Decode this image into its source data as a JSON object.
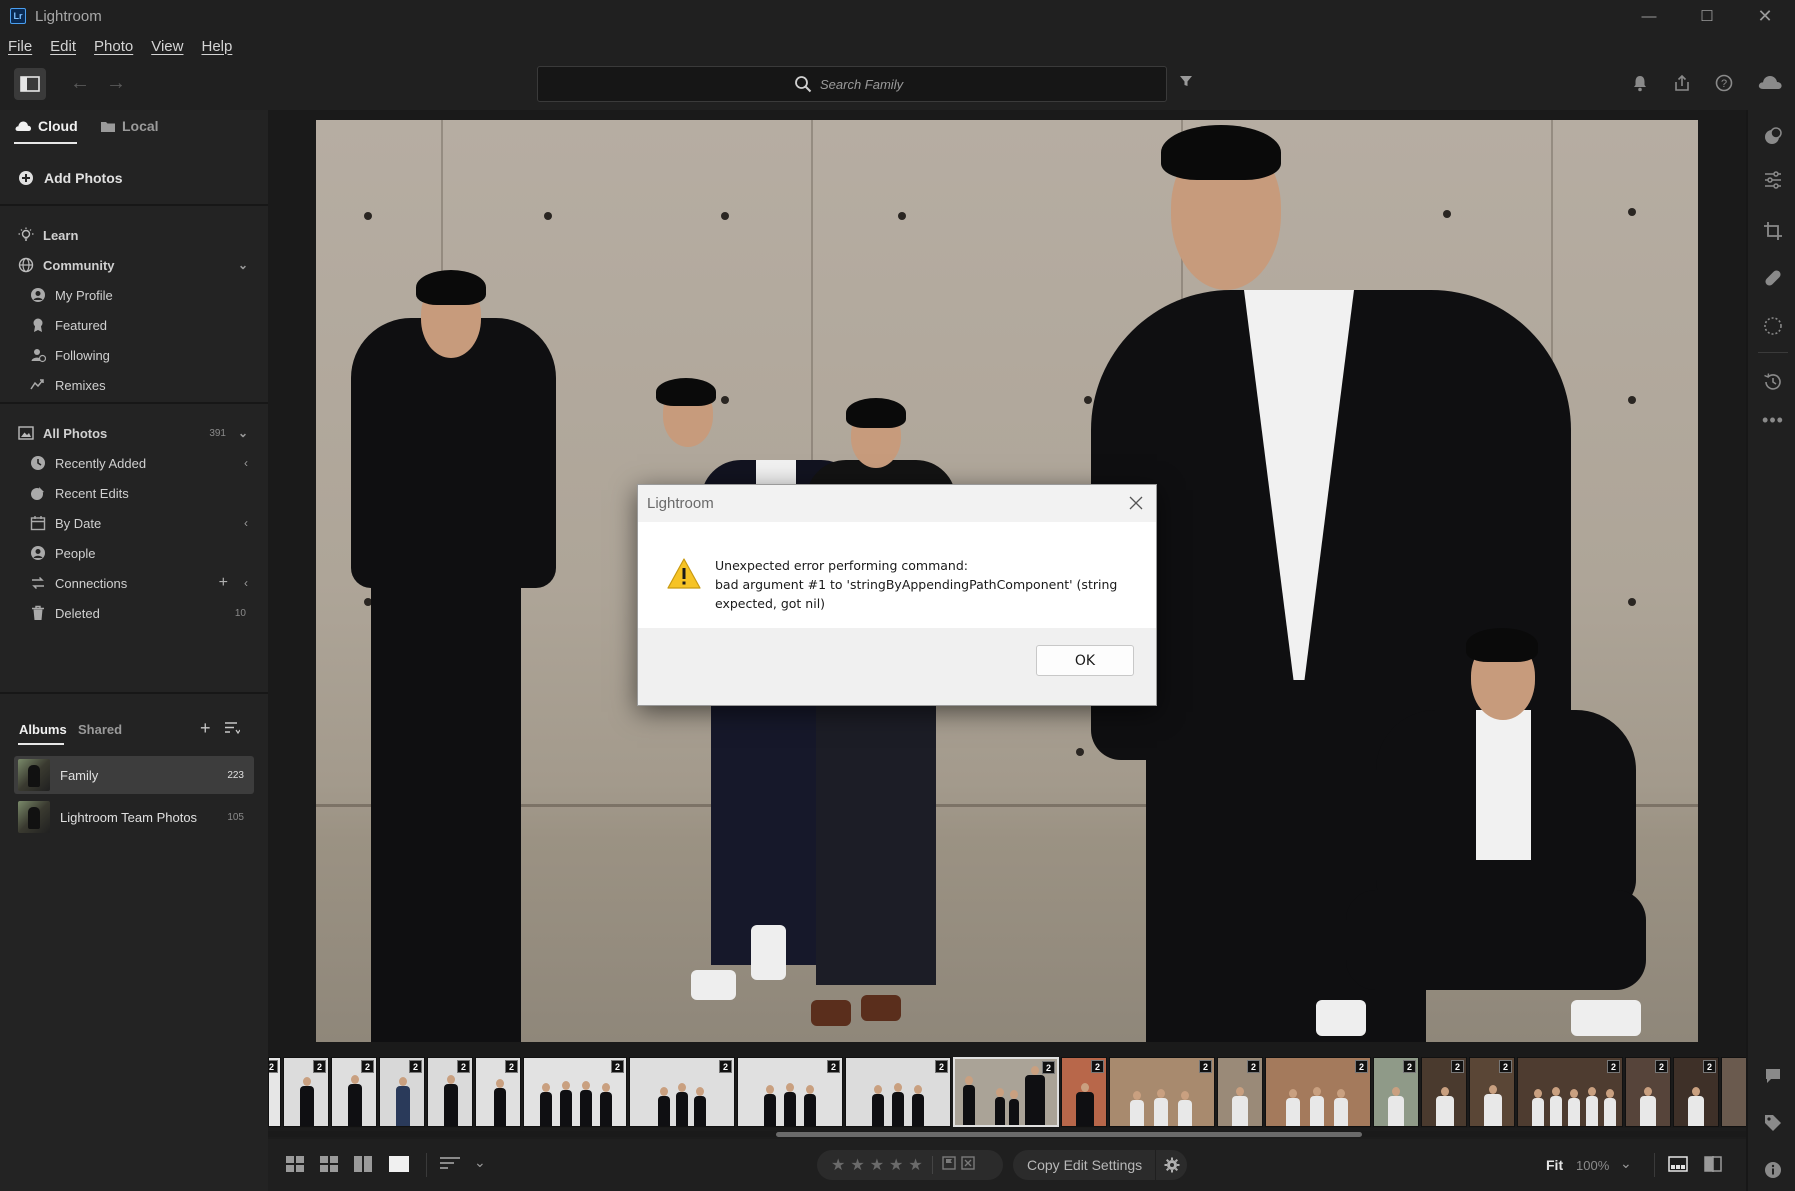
{
  "window": {
    "title": "Lightroom",
    "logo": "Lr",
    "controls": {
      "minimize": "—",
      "maximize": "☐",
      "close": "✕"
    }
  },
  "menu": [
    "File",
    "Edit",
    "Photo",
    "View",
    "Help"
  ],
  "toolbar": {
    "search_placeholder": "Search Family"
  },
  "left_panel": {
    "tabs": [
      {
        "label": "Cloud",
        "active": true
      },
      {
        "label": "Local",
        "active": false
      }
    ],
    "add_photos": "Add Photos",
    "learn": "Learn",
    "community": {
      "label": "Community",
      "items": [
        "My Profile",
        "Featured",
        "Following",
        "Remixes"
      ]
    },
    "all_photos": {
      "label": "All Photos",
      "count": "391"
    },
    "library_items": [
      {
        "label": "Recently Added"
      },
      {
        "label": "Recent Edits"
      },
      {
        "label": "By Date"
      },
      {
        "label": "People"
      },
      {
        "label": "Connections"
      },
      {
        "label": "Deleted",
        "count": "10"
      }
    ],
    "album_tabs": [
      {
        "label": "Albums",
        "active": true
      },
      {
        "label": "Shared",
        "active": false
      }
    ],
    "albums": [
      {
        "label": "Family",
        "count": "223",
        "selected": true
      },
      {
        "label": "Lightroom Team Photos",
        "count": "105",
        "selected": false
      }
    ]
  },
  "dialog": {
    "title": "Lightroom",
    "line1": "Unexpected error performing command:",
    "line2": "bad argument #1 to 'stringByAppendingPathComponent' (string expected, got nil)",
    "ok_label": "OK"
  },
  "filmstrip": {
    "badge": "2"
  },
  "bottom_bar": {
    "copy_edit_settings": "Copy Edit Settings",
    "fit": "Fit",
    "zoom": "100%"
  },
  "colors": {
    "accent": "#e8e8e8",
    "warning": "#f6c325",
    "panel": "#232323",
    "background": "#1c1c1c"
  }
}
